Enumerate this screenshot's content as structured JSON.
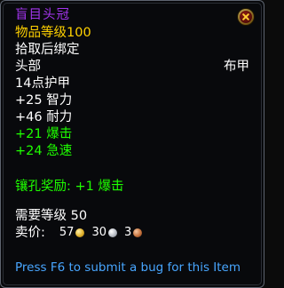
{
  "item": {
    "name": "盲目头冠",
    "item_level": "物品等级100",
    "bind": "拾取后绑定",
    "slot": "头部",
    "armor_type": "布甲",
    "armor": "14点护甲",
    "stats": [
      "+25 智力",
      "+46 耐力"
    ],
    "green_stats": [
      "+21 爆击",
      "+24 急速"
    ],
    "socket_bonus": "镶孔奖励: +1 爆击",
    "requirement": "需要等级 50",
    "sell_label": "卖价:",
    "sell_gold": "57",
    "sell_silver": "30",
    "sell_copper": "3",
    "bug_text": "Press F6 to submit a bug for this Item"
  },
  "colors": {
    "epic": "#a335ee",
    "item_level": "#ffd100",
    "green": "#1eff00",
    "link": "#48a6ff"
  }
}
